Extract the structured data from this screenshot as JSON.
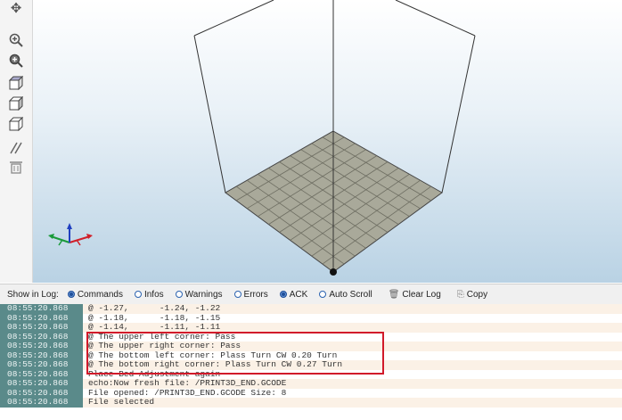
{
  "toolbar": {
    "icons": [
      "move-icon",
      "zoom-in-icon",
      "zoom-fit-icon",
      "view-iso-icon",
      "view-front-icon",
      "view-top-icon",
      "slice-icon",
      "trash-icon"
    ]
  },
  "log_toolbar": {
    "show_in_log_label": "Show in Log:",
    "commands": {
      "label": "Commands",
      "checked": true
    },
    "infos": {
      "label": "Infos",
      "checked": false
    },
    "warnings": {
      "label": "Warnings",
      "checked": false
    },
    "errors": {
      "label": "Errors",
      "checked": false
    },
    "ack": {
      "label": "ACK",
      "checked": true
    },
    "auto_scroll": {
      "label": "Auto Scroll",
      "checked": false
    },
    "clear_log": "Clear Log",
    "copy": "Copy"
  },
  "log": [
    {
      "time": "08:55:20.868",
      "text": "@ -1.27,      -1.24, -1.22"
    },
    {
      "time": "08:55:20.868",
      "text": "@ -1.18,      -1.18, -1.15"
    },
    {
      "time": "08:55:20.868",
      "text": "@ -1.14,      -1.11, -1.11"
    },
    {
      "time": "08:55:20.868",
      "text": "@ The upper left corner: Pass"
    },
    {
      "time": "08:55:20.868",
      "text": "@ The upper right corner: Pass"
    },
    {
      "time": "08:55:20.868",
      "text": "@ The bottom left corner: Plass Turn CW 0.20 Turn"
    },
    {
      "time": "08:55:20.868",
      "text": "@ The bottom right corner: Plass Turn CW 0.27 Turn"
    },
    {
      "time": "08:55:20.868",
      "text": "Place Bed Adjustment again"
    },
    {
      "time": "08:55:20.868",
      "text": "echo:Now fresh file: /PRINT3D_END.GCODE"
    },
    {
      "time": "08:55:20.868",
      "text": "File opened: /PRINT3D_END.GCODE Size: 8"
    },
    {
      "time": "08:55:20.868",
      "text": "File selected"
    }
  ],
  "colors": {
    "timestamp_bg": "#5a8a8a",
    "highlight_border": "#d11a2a",
    "bed_fill": "#a9a99a",
    "axis_x": "#d0202a",
    "axis_y": "#1a9a3a",
    "axis_z": "#2040c0"
  }
}
